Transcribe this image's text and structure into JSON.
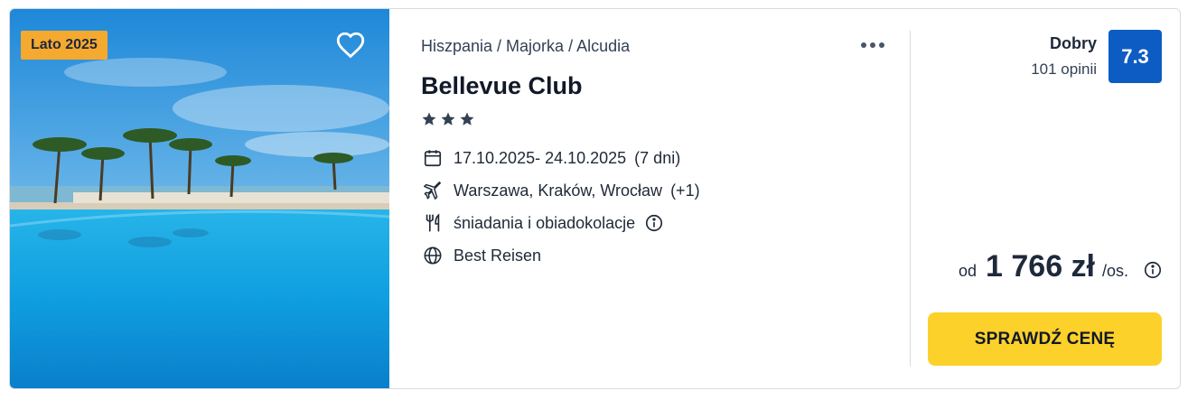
{
  "offer": {
    "badge": "Lato 2025",
    "breadcrumb": "Hiszpania / Majorka / Alcudia",
    "hotel_name": "Bellevue Club",
    "stars": 3,
    "dates": "17.10.2025- 24.10.2025",
    "duration": "(7 dni)",
    "departure": "Warszawa, Kraków, Wrocław",
    "departure_extra": "(+1)",
    "board": "śniadania i obiadokolacje",
    "operator": "Best Reisen"
  },
  "rating": {
    "label": "Dobry",
    "count": "101 opinii",
    "score": "7.3",
    "color": "#0d5cc4"
  },
  "price": {
    "prefix": "od",
    "amount": "1 766 zł",
    "suffix": "/os."
  },
  "cta": {
    "label": "SPRAWDŹ CENĘ",
    "color": "#fcd12a"
  },
  "icons": {
    "favorite": "heart-icon",
    "more": "more-dots-icon",
    "calendar": "calendar-icon",
    "flight": "plane-icon",
    "board": "cutlery-icon",
    "operator": "globe-icon",
    "info": "info-icon"
  },
  "colors": {
    "badge": "#f6a92f",
    "stars": "#334155"
  }
}
